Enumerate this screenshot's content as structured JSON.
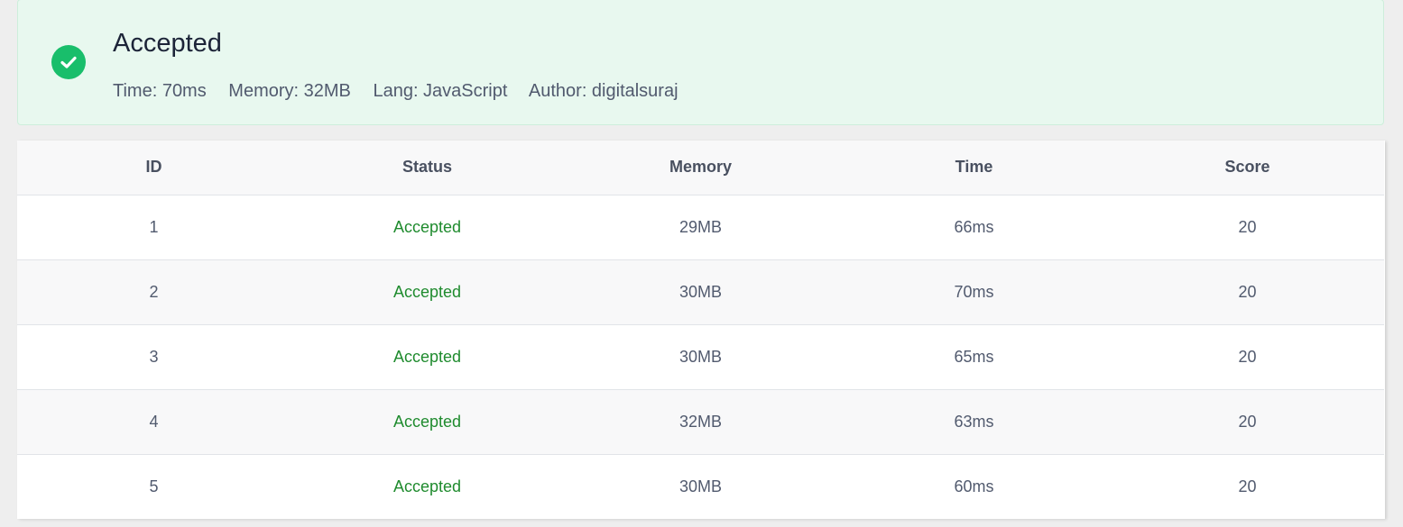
{
  "result": {
    "status": "Accepted",
    "status_color": "#19be6b",
    "icon": "check-circle-icon",
    "meta": {
      "time": "Time: 70ms",
      "memory": "Memory: 32MB",
      "lang": "Lang: JavaScript",
      "author": "Author: digitalsuraj"
    }
  },
  "table": {
    "columns": [
      "ID",
      "Status",
      "Memory",
      "Time",
      "Score"
    ],
    "rows": [
      {
        "id": "1",
        "status": "Accepted",
        "memory": "29MB",
        "time": "66ms",
        "score": "20"
      },
      {
        "id": "2",
        "status": "Accepted",
        "memory": "30MB",
        "time": "70ms",
        "score": "20"
      },
      {
        "id": "3",
        "status": "Accepted",
        "memory": "30MB",
        "time": "65ms",
        "score": "20"
      },
      {
        "id": "4",
        "status": "Accepted",
        "memory": "32MB",
        "time": "63ms",
        "score": "20"
      },
      {
        "id": "5",
        "status": "Accepted",
        "memory": "30MB",
        "time": "60ms",
        "score": "20"
      }
    ],
    "accepted_color": "#1f8b2e"
  }
}
